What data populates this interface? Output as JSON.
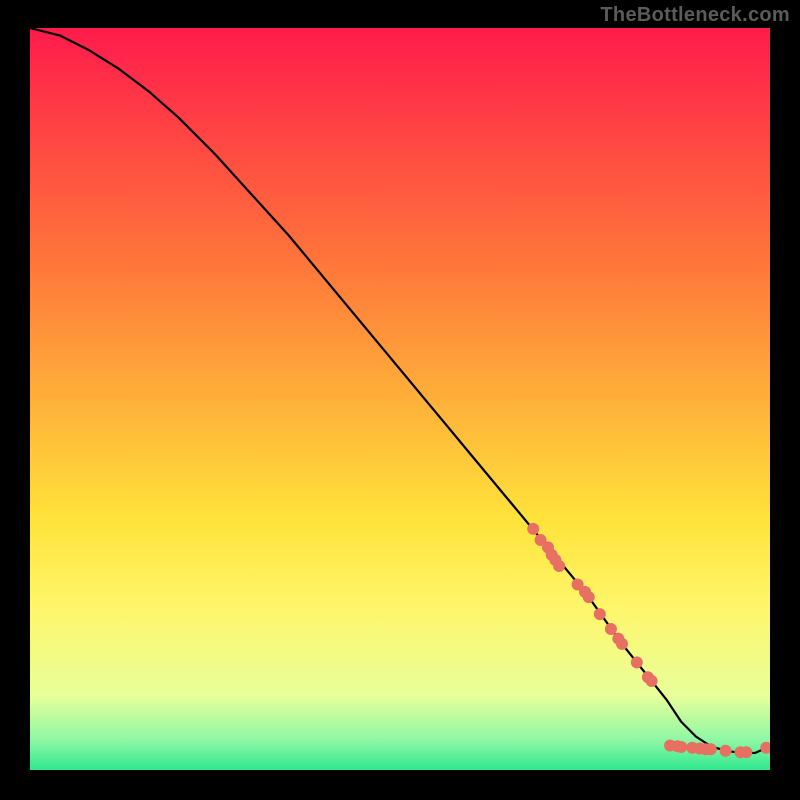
{
  "watermark": "TheBottleneck.com",
  "chart_data": {
    "type": "line",
    "title": "",
    "xlabel": "",
    "ylabel": "",
    "xlim": [
      0,
      100
    ],
    "ylim": [
      0,
      100
    ],
    "grid": false,
    "legend": false,
    "background_gradient_stops": [
      {
        "offset": 0.0,
        "color": "#ff1b4b"
      },
      {
        "offset": 0.33,
        "color": "#ff7a3a"
      },
      {
        "offset": 0.66,
        "color": "#ffe23a"
      },
      {
        "offset": 0.78,
        "color": "#fff66a"
      },
      {
        "offset": 0.9,
        "color": "#e8ff9a"
      },
      {
        "offset": 0.96,
        "color": "#8df7a5"
      },
      {
        "offset": 1.0,
        "color": "#2fe88f"
      }
    ],
    "curve": {
      "x": [
        0,
        4,
        8,
        12,
        16,
        20,
        25,
        30,
        35,
        40,
        45,
        50,
        55,
        60,
        65,
        70,
        75,
        80,
        82,
        84,
        86,
        88,
        90,
        92,
        94,
        96,
        98,
        100
      ],
      "y": [
        100,
        99,
        97,
        94.5,
        91.5,
        88,
        83,
        77.5,
        72,
        66,
        60,
        54,
        48,
        42,
        36,
        30,
        24,
        17,
        14.5,
        12,
        9.5,
        6.5,
        4.5,
        3.2,
        2.6,
        2.3,
        2.3,
        3.2
      ]
    },
    "points": {
      "color": "#e77062",
      "radius": 6,
      "xy": [
        [
          68,
          32.5
        ],
        [
          69,
          31
        ],
        [
          70,
          30
        ],
        [
          70.5,
          29
        ],
        [
          71,
          28.3
        ],
        [
          71.5,
          27.5
        ],
        [
          74,
          25
        ],
        [
          75,
          24
        ],
        [
          75.5,
          23.3
        ],
        [
          77,
          21
        ],
        [
          78.5,
          19
        ],
        [
          79.5,
          17.7
        ],
        [
          80,
          17
        ],
        [
          82,
          14.5
        ],
        [
          83.5,
          12.5
        ],
        [
          84,
          12
        ],
        [
          86.5,
          3.3
        ],
        [
          87.5,
          3.2
        ],
        [
          88,
          3.1
        ],
        [
          89.5,
          3.0
        ],
        [
          90.5,
          2.9
        ],
        [
          91.3,
          2.8
        ],
        [
          92.0,
          2.8
        ],
        [
          94.0,
          2.6
        ],
        [
          96.0,
          2.4
        ],
        [
          96.8,
          2.4
        ],
        [
          99.5,
          3.0
        ]
      ]
    }
  }
}
